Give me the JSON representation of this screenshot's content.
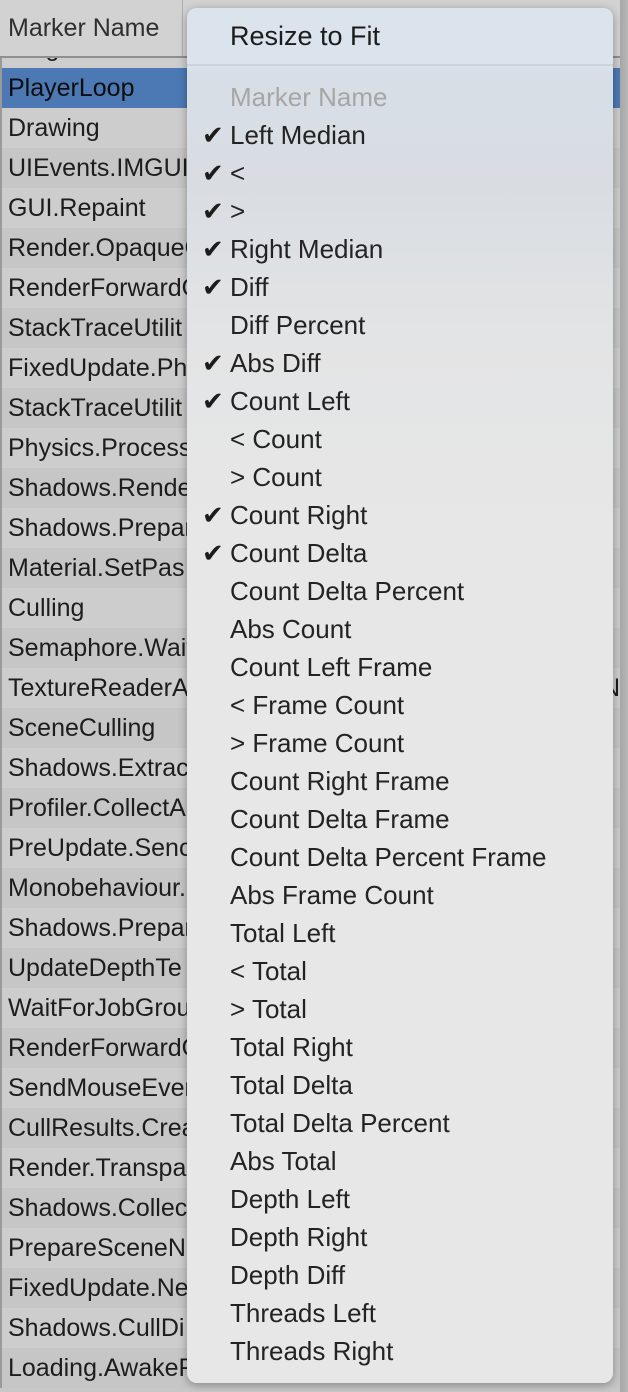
{
  "colors": {
    "selection_blue": "#4c79b4",
    "menu_top": "#dbe3ec",
    "menu_bottom": "#e7e7e7",
    "row_odd": "#c6c6c6",
    "row_even": "#cdcdcd",
    "disabled_text": "#a6a6a6"
  },
  "table": {
    "headers": [
      "Marker Name",
      ""
    ],
    "partial_top_row": "Diagnostics",
    "rows": [
      {
        "name": "PlayerLoop",
        "selected": true,
        "second": ""
      },
      {
        "name": "Drawing",
        "selected": false,
        "second": ""
      },
      {
        "name": "UIEvents.IMGUI",
        "selected": false,
        "second": ""
      },
      {
        "name": "GUI.Repaint",
        "selected": false,
        "second": ""
      },
      {
        "name": "Render.OpaqueG",
        "selected": false,
        "second": ""
      },
      {
        "name": "RenderForwardO",
        "selected": false,
        "second": ""
      },
      {
        "name": "StackTraceUtilit",
        "selected": false,
        "second": ""
      },
      {
        "name": "FixedUpdate.Phy",
        "selected": false,
        "second": ""
      },
      {
        "name": "StackTraceUtilit",
        "selected": false,
        "second": ""
      },
      {
        "name": "Physics.Process",
        "selected": false,
        "second": ""
      },
      {
        "name": "Shadows.Rende",
        "selected": false,
        "second": ""
      },
      {
        "name": "Shadows.Prepar",
        "selected": false,
        "second": ""
      },
      {
        "name": "Material.SetPas",
        "selected": false,
        "second": ""
      },
      {
        "name": "Culling",
        "selected": false,
        "second": ""
      },
      {
        "name": "Semaphore.Wait",
        "selected": false,
        "second": ""
      },
      {
        "name": "TextureReaderA",
        "selected": false,
        "second": "Ne"
      },
      {
        "name": "SceneCulling",
        "selected": false,
        "second": ""
      },
      {
        "name": "Shadows.Extrac",
        "selected": false,
        "second": ""
      },
      {
        "name": "Profiler.CollectA",
        "selected": false,
        "second": ""
      },
      {
        "name": "PreUpdate.Senc",
        "selected": false,
        "second": ""
      },
      {
        "name": "Monobehaviour.",
        "selected": false,
        "second": ""
      },
      {
        "name": "Shadows.Prepar",
        "selected": false,
        "second": ""
      },
      {
        "name": "UpdateDepthTe",
        "selected": false,
        "second": ""
      },
      {
        "name": "WaitForJobGrou",
        "selected": false,
        "second": ""
      },
      {
        "name": "RenderForwardO",
        "selected": false,
        "second": ""
      },
      {
        "name": "SendMouseEver",
        "selected": false,
        "second": ""
      },
      {
        "name": "CullResults.Crea",
        "selected": false,
        "second": ""
      },
      {
        "name": "Render.Transpa",
        "selected": false,
        "second": ""
      },
      {
        "name": "Shadows.Collec",
        "selected": false,
        "second": ""
      },
      {
        "name": "PrepareSceneN",
        "selected": false,
        "second": ""
      },
      {
        "name": "FixedUpdate.Ne",
        "selected": false,
        "second": ""
      },
      {
        "name": "Shadows.CullDi",
        "selected": false,
        "second": ""
      },
      {
        "name": "Loading.AwakeF",
        "selected": false,
        "second": ""
      }
    ]
  },
  "context_menu": {
    "header": "Resize to Fit",
    "check_glyph": "✔",
    "items": [
      {
        "label": "Marker Name",
        "checked": false,
        "disabled": true
      },
      {
        "label": "Left Median",
        "checked": true,
        "disabled": false
      },
      {
        "label": "<",
        "checked": true,
        "disabled": false
      },
      {
        "label": ">",
        "checked": true,
        "disabled": false
      },
      {
        "label": "Right Median",
        "checked": true,
        "disabled": false
      },
      {
        "label": "Diff",
        "checked": true,
        "disabled": false
      },
      {
        "label": "Diff Percent",
        "checked": false,
        "disabled": false
      },
      {
        "label": "Abs Diff",
        "checked": true,
        "disabled": false
      },
      {
        "label": "Count Left",
        "checked": true,
        "disabled": false
      },
      {
        "label": "< Count",
        "checked": false,
        "disabled": false
      },
      {
        "label": "> Count",
        "checked": false,
        "disabled": false
      },
      {
        "label": "Count Right",
        "checked": true,
        "disabled": false
      },
      {
        "label": "Count Delta",
        "checked": true,
        "disabled": false
      },
      {
        "label": "Count Delta Percent",
        "checked": false,
        "disabled": false
      },
      {
        "label": "Abs Count",
        "checked": false,
        "disabled": false
      },
      {
        "label": "Count Left Frame",
        "checked": false,
        "disabled": false
      },
      {
        "label": "< Frame Count",
        "checked": false,
        "disabled": false
      },
      {
        "label": "> Frame Count",
        "checked": false,
        "disabled": false
      },
      {
        "label": "Count Right Frame",
        "checked": false,
        "disabled": false
      },
      {
        "label": "Count Delta Frame",
        "checked": false,
        "disabled": false
      },
      {
        "label": "Count Delta Percent Frame",
        "checked": false,
        "disabled": false
      },
      {
        "label": "Abs Frame Count",
        "checked": false,
        "disabled": false
      },
      {
        "label": "Total Left",
        "checked": false,
        "disabled": false
      },
      {
        "label": "< Total",
        "checked": false,
        "disabled": false
      },
      {
        "label": "> Total",
        "checked": false,
        "disabled": false
      },
      {
        "label": "Total Right",
        "checked": false,
        "disabled": false
      },
      {
        "label": "Total Delta",
        "checked": false,
        "disabled": false
      },
      {
        "label": "Total Delta Percent",
        "checked": false,
        "disabled": false
      },
      {
        "label": "Abs Total",
        "checked": false,
        "disabled": false
      },
      {
        "label": "Depth Left",
        "checked": false,
        "disabled": false
      },
      {
        "label": "Depth Right",
        "checked": false,
        "disabled": false
      },
      {
        "label": "Depth Diff",
        "checked": false,
        "disabled": false
      },
      {
        "label": "Threads Left",
        "checked": false,
        "disabled": false
      },
      {
        "label": "Threads Right",
        "checked": false,
        "disabled": false
      }
    ]
  }
}
